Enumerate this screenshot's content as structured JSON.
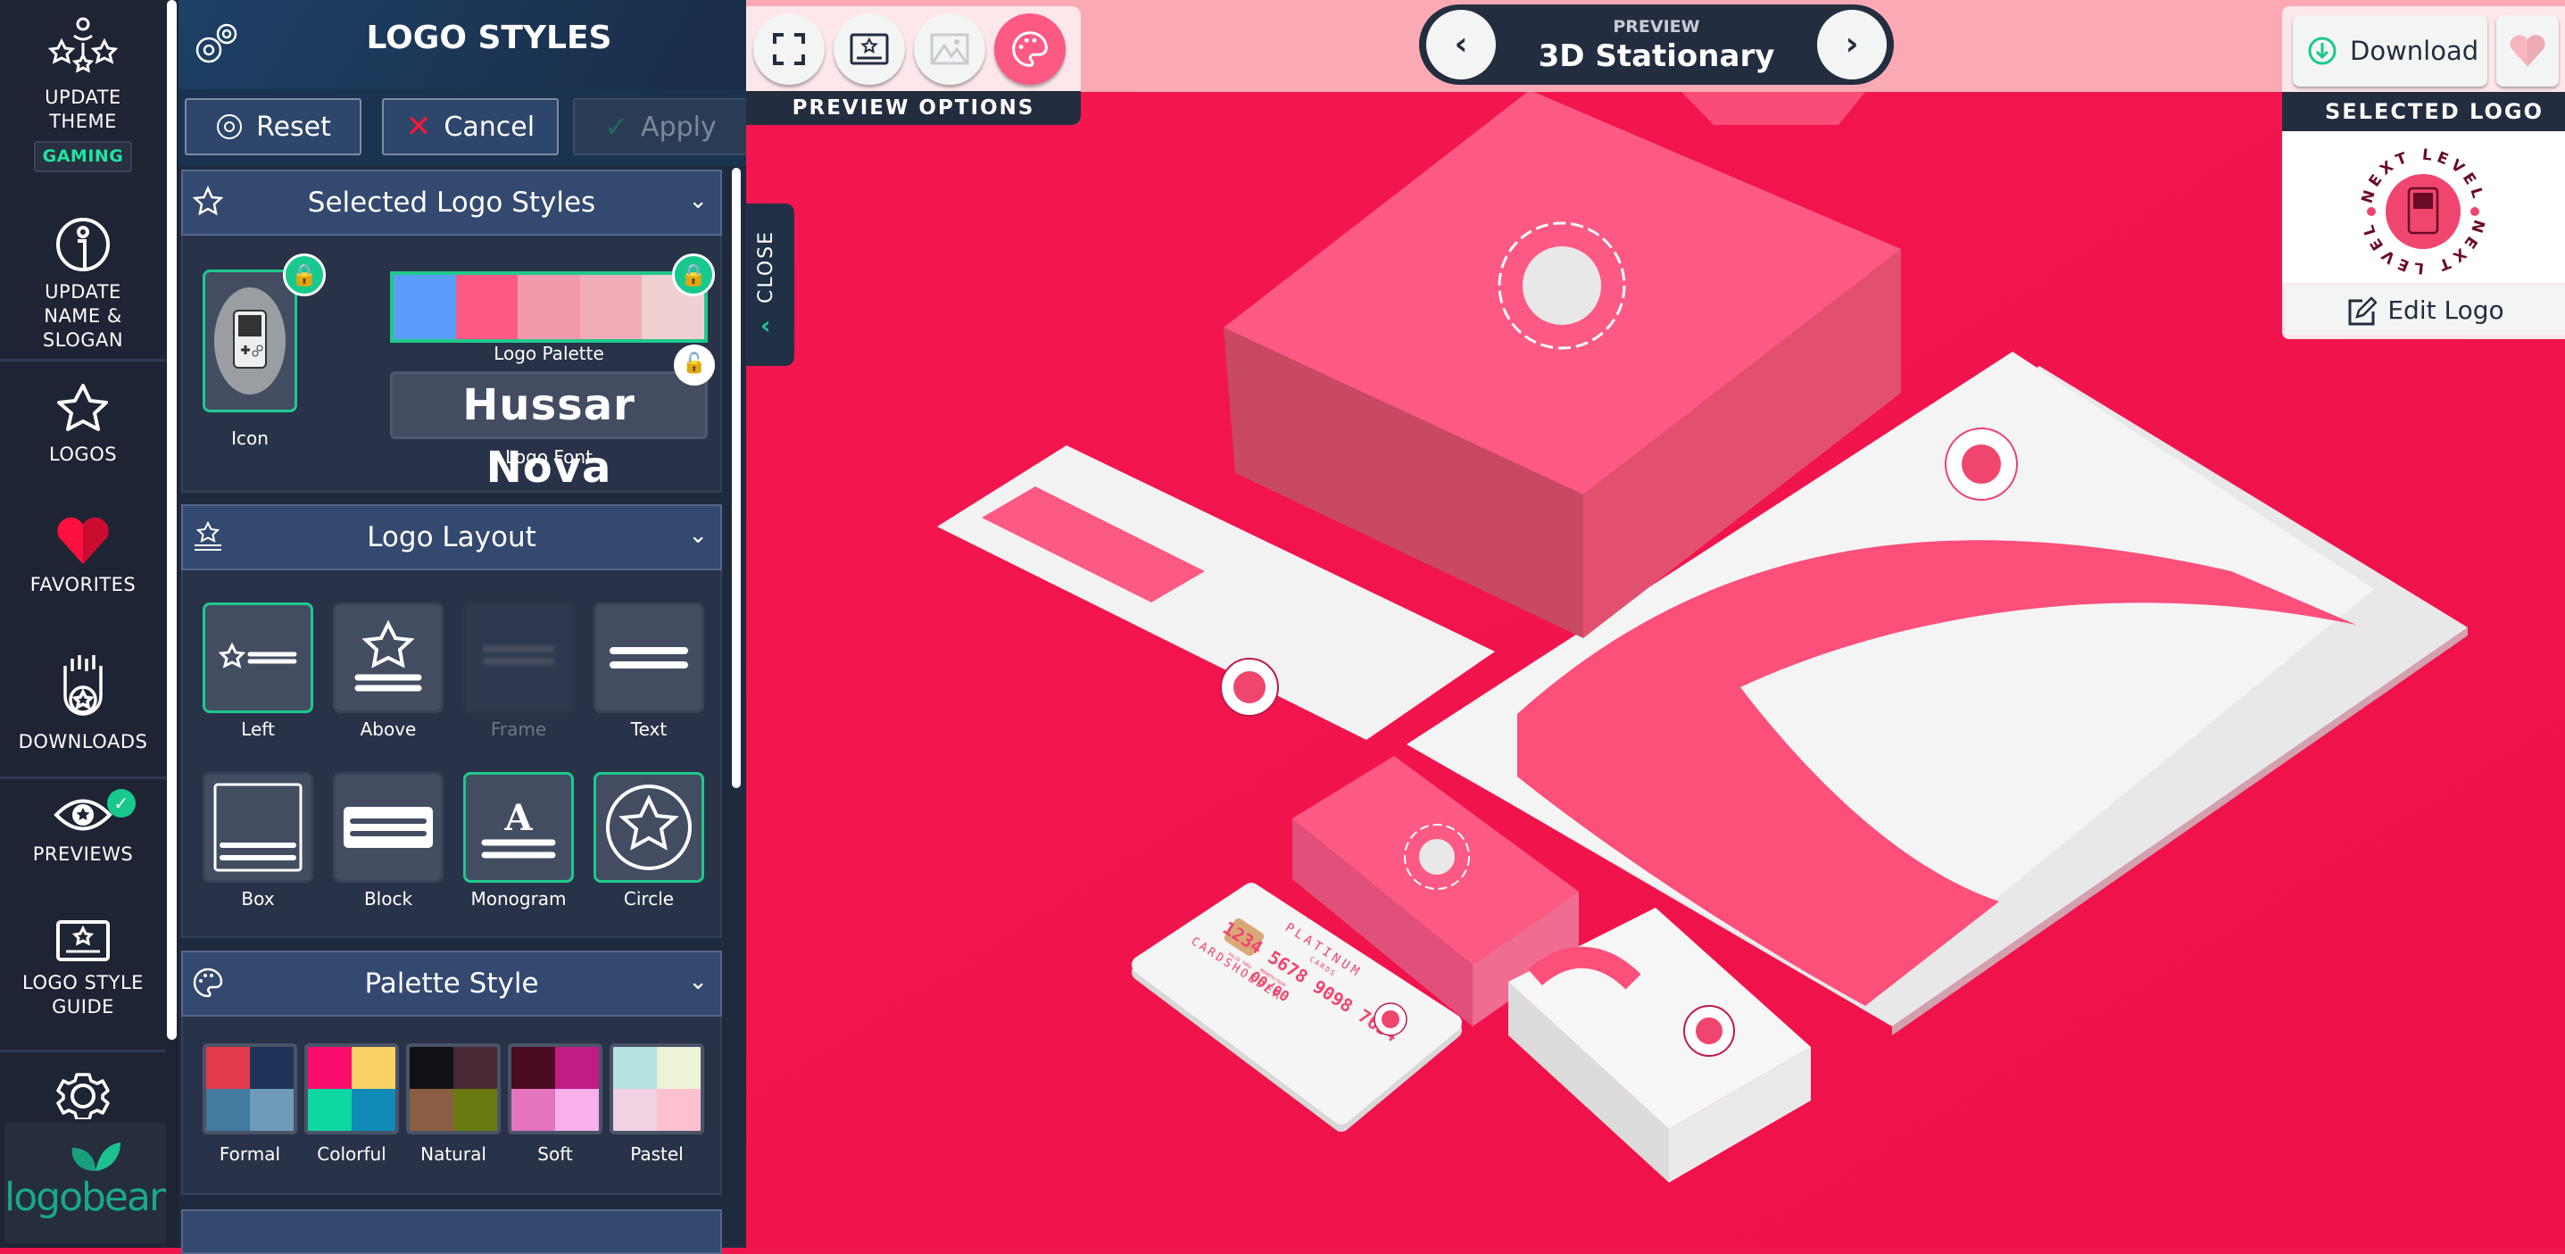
{
  "nav": {
    "update_theme": "UPDATE THEME",
    "theme_badge": "GAMING",
    "update_name": "UPDATE NAME & SLOGAN",
    "logos": "LOGOS",
    "favorites": "FAVORITES",
    "downloads": "DOWNLOADS",
    "previews": "PREVIEWS",
    "style_guide": "LOGO STYLE GUIDE",
    "brand": "logobean"
  },
  "panel": {
    "title": "LOGO STYLES",
    "reset": "Reset",
    "cancel": "Cancel",
    "apply": "Apply",
    "selected": {
      "title": "Selected Logo Styles",
      "icon_label": "Icon",
      "palette_label": "Logo Palette",
      "font_label": "Logo Font",
      "font_name": "Hussar Nova",
      "palette_colors": [
        "#5b9dfb",
        "#fc5a84",
        "#f09aab",
        "#f0adb8",
        "#f0d0d0"
      ]
    },
    "layout": {
      "title": "Logo Layout",
      "items": [
        {
          "label": "Left",
          "selected": true
        },
        {
          "label": "Above",
          "selected": false
        },
        {
          "label": "Frame",
          "selected": false,
          "disabled": true
        },
        {
          "label": "Text",
          "selected": false
        },
        {
          "label": "Box",
          "selected": false
        },
        {
          "label": "Block",
          "selected": false
        },
        {
          "label": "Monogram",
          "selected": true
        },
        {
          "label": "Circle",
          "selected": true
        }
      ]
    },
    "palette_style": {
      "title": "Palette Style",
      "items": [
        {
          "label": "Formal",
          "colors": [
            "#e33a49",
            "#1e3357",
            "#437aa0",
            "#6f9ab9"
          ]
        },
        {
          "label": "Colorful",
          "colors": [
            "#f90c6c",
            "#fbd166",
            "#0ed7a2",
            "#0f8ab7"
          ]
        },
        {
          "label": "Natural",
          "colors": [
            "#121116",
            "#4a2834",
            "#8b5e44",
            "#6a7a10"
          ]
        },
        {
          "label": "Soft",
          "colors": [
            "#4a0a20",
            "#c11c85",
            "#e474bd",
            "#f7b0ea"
          ]
        },
        {
          "label": "Pastel",
          "colors": [
            "#b5e1e1",
            "#edf3d6",
            "#f0d2e2",
            "#fcc0cf"
          ]
        }
      ]
    },
    "close": "CLOSE"
  },
  "preview": {
    "options_label": "PREVIEW OPTIONS",
    "label": "PREVIEW",
    "title": "3D Stationary",
    "accent": "#fc5a84",
    "background": "#f0164e"
  },
  "right": {
    "download": "Download",
    "selected_logo": "SELECTED LOGO",
    "edit_logo": "Edit Logo",
    "logo_text": "NEXT LEVEL"
  },
  "card": {
    "brand": "PLATINUM",
    "sub": "CARDS",
    "number": "1234 5678 9098 7654",
    "valid": "VALID THRU",
    "month_year": "MOUNTH/YEAR",
    "expiry": "00/00",
    "holder": "CARDSHOLDER"
  }
}
